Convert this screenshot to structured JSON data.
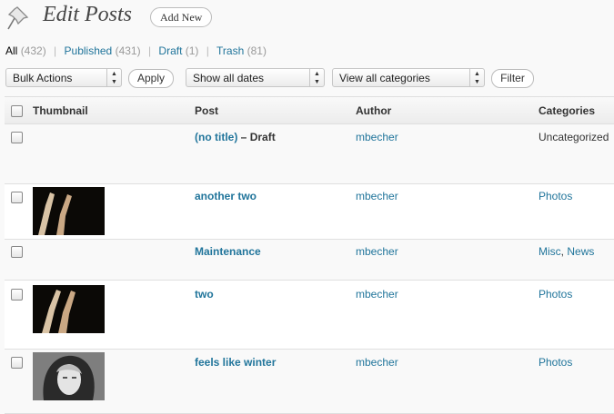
{
  "header": {
    "title": "Edit Posts",
    "add_new_label": "Add New"
  },
  "filters": {
    "all_label": "All",
    "all_count": "(432)",
    "published_label": "Published",
    "published_count": "(431)",
    "draft_label": "Draft",
    "draft_count": "(1)",
    "trash_label": "Trash",
    "trash_count": "(81)"
  },
  "toolbar": {
    "bulk_actions": "Bulk Actions",
    "apply_label": "Apply",
    "dates": "Show all dates",
    "categories": "View all categories",
    "filter_label": "Filter"
  },
  "table": {
    "headers": {
      "thumbnail": "Thumbnail",
      "post": "Post",
      "author": "Author",
      "categories": "Categories"
    },
    "rows": [
      {
        "title": "(no title)",
        "state_sep": "–",
        "state": "Draft",
        "author": "mbecher",
        "categories": "Uncategorized"
      },
      {
        "title": "another two",
        "author": "mbecher",
        "categories": "Photos"
      },
      {
        "title": "Maintenance",
        "author": "mbecher",
        "categories": "Misc",
        "cat_sep": ",",
        "categories2": "News"
      },
      {
        "title": "two",
        "author": "mbecher",
        "categories": "Photos"
      },
      {
        "title": "feels like winter",
        "author": "mbecher",
        "categories": "Photos"
      }
    ]
  },
  "icons": {
    "page": "pushpin-icon"
  },
  "colors": {
    "link": "#21759b",
    "title": "#464646"
  }
}
